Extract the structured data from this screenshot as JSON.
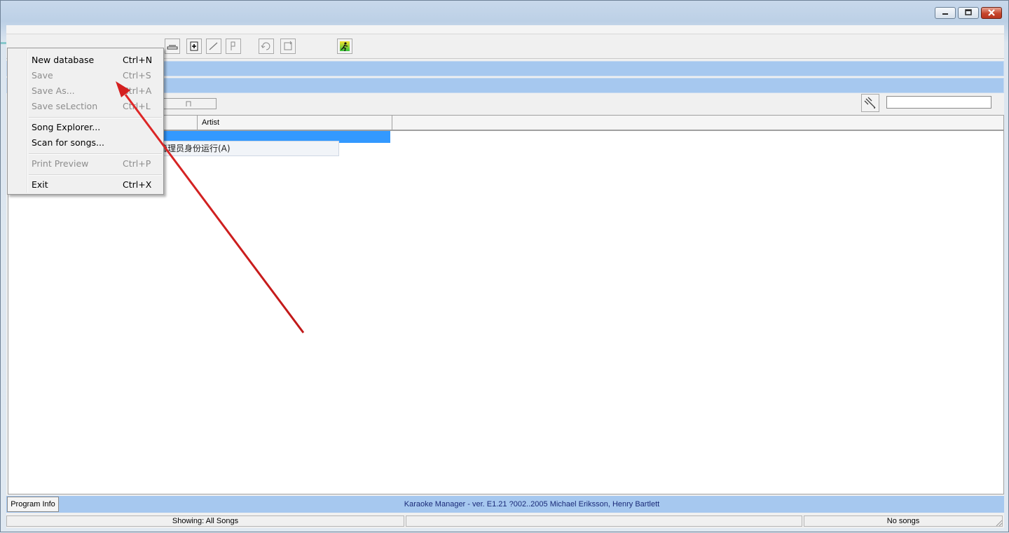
{
  "window": {
    "controls": [
      "minimize",
      "maximize",
      "close"
    ]
  },
  "toolbar": {
    "icons": [
      "select-tool-icon",
      "add-item-icon",
      "line-tool-icon",
      "page-icon",
      "rotate-left-icon",
      "rotate-right-icon",
      "run-icon"
    ]
  },
  "search": {
    "value": "",
    "placeholder": ""
  },
  "list": {
    "columns": [
      "",
      "Artist"
    ],
    "rows": []
  },
  "file_menu": {
    "items": [
      {
        "label": "New database",
        "shortcut": "Ctrl+N",
        "enabled": true
      },
      {
        "label": "Save",
        "shortcut": "Ctrl+S",
        "enabled": false
      },
      {
        "label": "Save As...",
        "shortcut": "Ctrl+A",
        "enabled": false
      },
      {
        "label": "Save seLection",
        "shortcut": "Ctrl+L",
        "enabled": false
      },
      {
        "label": "Song Explorer...",
        "shortcut": "",
        "enabled": true
      },
      {
        "label": "Scan for songs...",
        "shortcut": "",
        "enabled": true
      },
      {
        "label": "Print Preview",
        "shortcut": "Ctrl+P",
        "enabled": false
      },
      {
        "label": "Exit",
        "shortcut": "Ctrl+X",
        "enabled": true
      }
    ]
  },
  "context_popup": {
    "label": "以管理员身份运行(A)",
    "icon": "uac-shield-icon"
  },
  "bottom_bar": {
    "info_button": "Program Info",
    "about": "Karaoke Manager - ver. E1.21 ?002..2005 Michael Eriksson, Henry Bartlett"
  },
  "statusbar": {
    "showing": "Showing: All Songs",
    "middle": "",
    "count": "No songs"
  },
  "colors": {
    "highlight_bar": "#a6c8ef",
    "selection": "#3399ff",
    "annotation_arrow": "#d42020",
    "about_text": "#1a2a78"
  }
}
